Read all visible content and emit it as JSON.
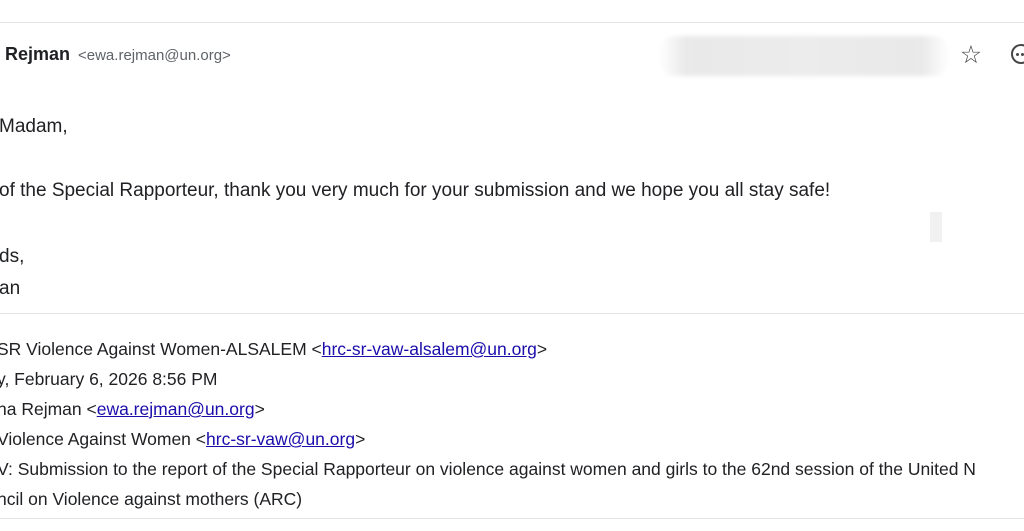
{
  "email": {
    "sender_name": "Rejman",
    "sender_email": "<ewa.rejman@un.org>",
    "body": {
      "salutation": "Madam,",
      "message": "of the Special Rapporteur, thank you very much for your submission and we hope you all stay safe!",
      "closing": "ds,",
      "signature": "an"
    },
    "quoted_header": {
      "from_text": "SR Violence Against Women-ALSALEM <",
      "from_link": "hrc-sr-vaw-alsalem@un.org",
      "from_end": ">",
      "sent": "y, February 6, 2026 8:56 PM",
      "to_text": "na Rejman <",
      "to_link": "ewa.rejman@un.org",
      "to_end": ">",
      "cc_text": " Violence Against Women <",
      "cc_link": "hrc-sr-vaw@un.org",
      "cc_end": ">",
      "subject_line1": "V: Submission to the report of the Special Rapporteur on violence against women and girls to the 62nd session of the United N",
      "subject_line2": "ncil on Violence against mothers (ARC)"
    }
  },
  "icons": {
    "star": "star-icon",
    "more": "more-options-icon"
  },
  "colors": {
    "link": "#1a0dab",
    "text": "#202124",
    "secondary": "#5f6368"
  }
}
